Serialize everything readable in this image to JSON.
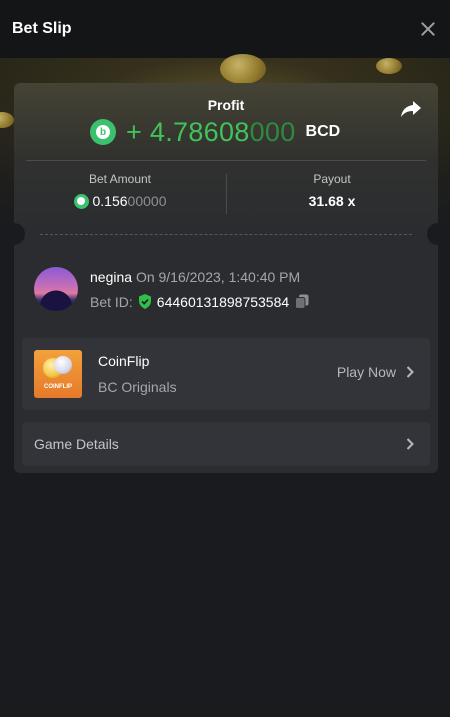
{
  "header": {
    "title": "Bet Slip"
  },
  "profit": {
    "label": "Profit",
    "sign": "+",
    "value_main": "4.78608",
    "value_zeros": "000",
    "currency": "BCD"
  },
  "bet_amount": {
    "label": "Bet Amount",
    "value_main": "0.156",
    "value_zeros": "00000"
  },
  "payout": {
    "label": "Payout",
    "value": "31.68 x"
  },
  "user": {
    "name": "negina",
    "timestamp": "On 9/16/2023, 1:40:40 PM",
    "bet_id_label": "Bet ID:",
    "bet_id": "64460131898753584"
  },
  "game": {
    "name": "CoinFlip",
    "provider": "BC Originals",
    "thumb_label": "COINFLIP",
    "play_label": "Play Now"
  },
  "details": {
    "label": "Game Details"
  },
  "colors": {
    "accent_green": "#3fc35a",
    "background": "#1a1b1e",
    "card": "#2a2c30"
  }
}
